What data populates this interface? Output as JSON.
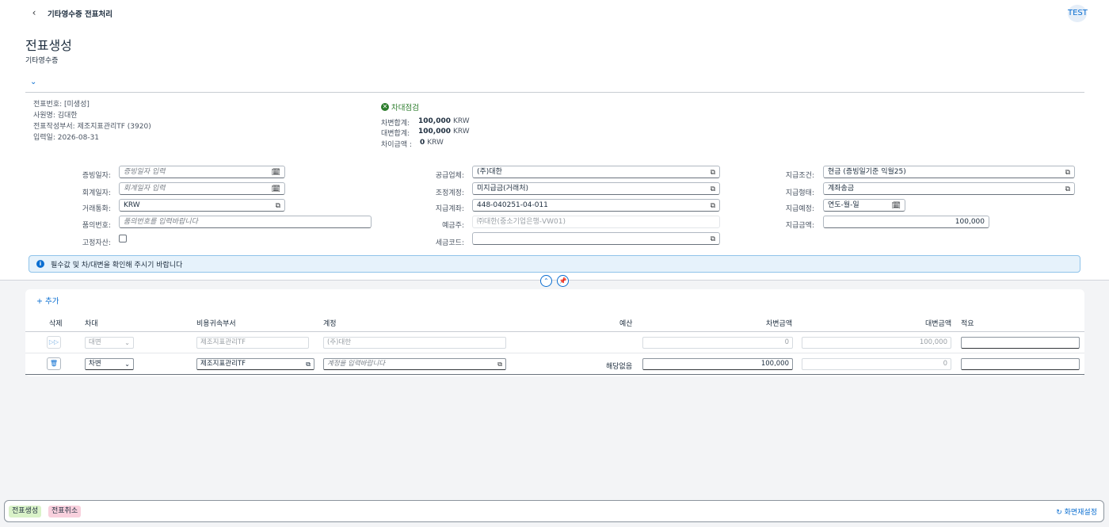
{
  "shell": {
    "title": "기타영수증 전표처리",
    "user": "TEST"
  },
  "header": {
    "title": "전표생성",
    "subtitle": "기타영수증"
  },
  "meta": {
    "doc_no": "전표번호: [미생성]",
    "employee": "사원명: 김대한",
    "dept": "전표작성부서: 제조지표관리TF (3920)",
    "date": "입력일: 2026-08-31"
  },
  "balance": {
    "status": "차대점검",
    "debit_label": "차변합계:",
    "debit_value": "100,000",
    "credit_label": "대변합계:",
    "credit_value": "100,000",
    "diff_label": "차이금액 :",
    "diff_value": "0",
    "currency": "KRW"
  },
  "form": {
    "evidence_date": {
      "label": "증빙일자:",
      "placeholder": "증빙일자 입력"
    },
    "account_date": {
      "label": "회계일자:",
      "placeholder": "회계일자 입력"
    },
    "currency": {
      "label": "거래통화:",
      "value": "KRW"
    },
    "approval_no": {
      "label": "품의번호:",
      "placeholder": "품의번호를 입력바랍니다"
    },
    "fixed_asset": {
      "label": "고정자산:"
    },
    "vendor": {
      "label": "공급업체:",
      "value": "(주)대한"
    },
    "adjust_account": {
      "label": "조정계정:",
      "value": "미지급금(거래처)"
    },
    "pay_account": {
      "label": "지급계좌:",
      "value": "448-040251-04-011"
    },
    "depositor": {
      "label": "예금주:",
      "value": "㈜대한(중소기업은행-VW01)"
    },
    "tax_code": {
      "label": "세금코드:",
      "value": ""
    },
    "pay_terms": {
      "label": "지급조건:",
      "value": "현금 (증빙일기준 익월25)"
    },
    "pay_type": {
      "label": "지급형태:",
      "value": "계좌송금"
    },
    "pay_due": {
      "label": "지급예정:",
      "value": "연도-월-일"
    },
    "pay_amount": {
      "label": "지급금액:",
      "value": "100,000"
    }
  },
  "info_message": "필수값 및 차/대변을 확인해 주시기 바랍니다",
  "table": {
    "add_label": "추가",
    "columns": [
      "삭제",
      "차대",
      "비용귀속부서",
      "계정",
      "예산",
      "차변금액",
      "대변금액",
      "적요"
    ],
    "rows": [
      {
        "dc": "대변",
        "dept": "제조지표관리TF",
        "account": "(주)대한",
        "budget": "",
        "debit": "0",
        "credit": "100,000",
        "memo": ""
      },
      {
        "dc": "차변",
        "dept": "제조지표관리TF",
        "account": "계정을 입력바랍니다",
        "budget": "해당없음",
        "debit": "100,000",
        "credit": "0",
        "memo": ""
      }
    ]
  },
  "footer": {
    "create": "전표생성",
    "cancel": "전표취소",
    "reset": "화면재설정"
  },
  "colors": {
    "accent": "#0a6ed1",
    "success": "#2b7c2b",
    "create_badge": "#d9f2c8",
    "cancel_badge": "#f8d0dd"
  }
}
